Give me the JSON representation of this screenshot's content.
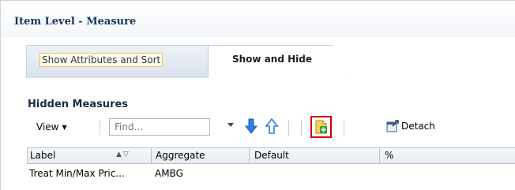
{
  "panel": {
    "title": "Item Level - Measure"
  },
  "tabs": [
    {
      "label": "Show Attributes and Sort",
      "active": false
    },
    {
      "label": "Show and Hide",
      "active": true
    }
  ],
  "section": {
    "title": "Hidden Measures"
  },
  "toolbar": {
    "view_label": "View",
    "find_placeholder": "Find...",
    "detach_label": "Detach",
    "icons": [
      "chevron-down-icon",
      "arrow-down-icon",
      "arrow-up-icon",
      "add-document-icon",
      "detach-icon"
    ]
  },
  "table": {
    "columns": [
      "Label",
      "Aggregate",
      "Default",
      "%"
    ],
    "rows": [
      {
        "label": "Treat Min/Max Pric...",
        "aggregate": "AMBG",
        "default": "",
        "percent": ""
      }
    ]
  },
  "colors": {
    "title": "#18365e",
    "highlight": "#d10000",
    "arrow": "#2f7de1"
  }
}
